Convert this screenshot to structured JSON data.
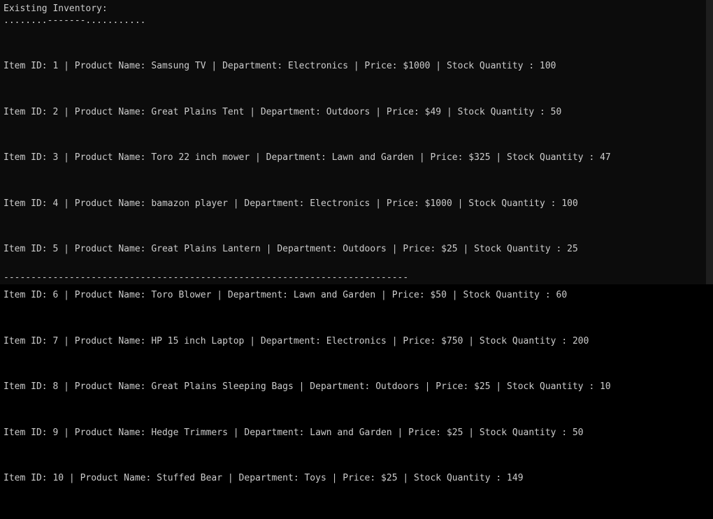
{
  "terminal": {
    "header": "Existing Inventory:",
    "separator_top": "........-------...........",
    "rows": [
      "Item ID: 1 | Product Name: Samsung TV | Department: Electronics | Price: $1000 | Stock Quantity : 100",
      "Item ID: 2 | Product Name: Great Plains Tent | Department: Outdoors | Price: $49 | Stock Quantity : 50",
      "Item ID: 3 | Product Name: Toro 22 inch mower | Department: Lawn and Garden | Price: $325 | Stock Quantity : 47",
      "Item ID: 4 | Product Name: bamazon player | Department: Electronics | Price: $1000 | Stock Quantity : 100",
      "Item ID: 5 | Product Name: Great Plains Lantern | Department: Outdoors | Price: $25 | Stock Quantity : 25",
      "Item ID: 6 | Product Name: Toro Blower | Department: Lawn and Garden | Price: $50 | Stock Quantity : 60",
      "Item ID: 7 | Product Name: HP 15 inch Laptop | Department: Electronics | Price: $750 | Stock Quantity : 200",
      "Item ID: 8 | Product Name: Great Plains Sleeping Bags | Department: Outdoors | Price: $25 | Stock Quantity : 10",
      "Item ID: 9 | Product Name: Hedge Trimmers | Department: Lawn and Garden | Price: $25 | Stock Quantity : 50",
      "Item ID: 10 | Product Name: Stuffed Bear | Department: Toys | Price: $25 | Stock Quantity : 149"
    ],
    "separator_bottom": "--------------------------------------------------------------------------",
    "colors": {
      "background": "#0c0c0c",
      "text": "#cccccc"
    }
  }
}
